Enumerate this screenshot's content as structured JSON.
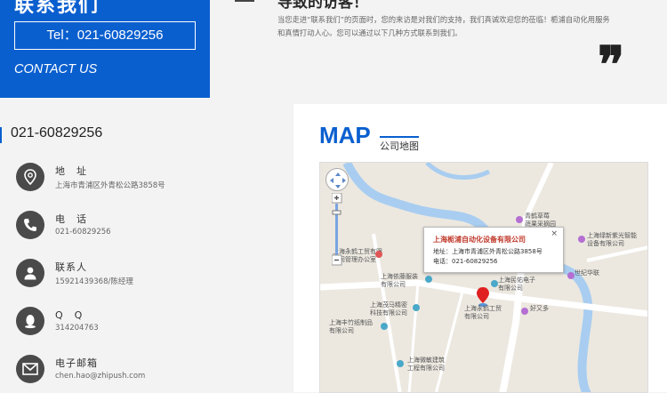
{
  "banner": {
    "title": "联系我们",
    "tel": "Tel：021-60829256",
    "contact_us": "CONTACT US"
  },
  "intro": {
    "heading": "导致的访客！",
    "text": "当您走进“联系我们”的页面时，您的来访是对我们的支持，我们真诚欢迎您的莅临！栀浦自动化用服务和真情打动人心。您可以通过以下几种方式联系到我们。",
    "quote": "❞"
  },
  "contact": {
    "phone_heading": "021-60829256",
    "items": [
      {
        "icon": "location-pin-icon",
        "label": "地　址",
        "value": "上海市青浦区外青松公路3858号"
      },
      {
        "icon": "phone-icon",
        "label": "电　话",
        "value": "021-60829256"
      },
      {
        "icon": "person-icon",
        "label": "联系人",
        "value": "15921439368/陈经理"
      },
      {
        "icon": "qq-icon",
        "label": "Q　Q",
        "value": "314204763"
      },
      {
        "icon": "email-icon",
        "label": "电子邮箱",
        "value": "chen.hao@zhipush.com"
      }
    ]
  },
  "map": {
    "title": "MAP",
    "subtitle": "公司地图",
    "popup": {
      "title": "上海栀浦自动化设备有限公司",
      "address": "地址：上海市青浦区外青松公路3858号",
      "phone": "电话：021-60829256",
      "close": "×"
    },
    "labels": [
      {
        "text": "青鹤草莓\n蔬果采摘园"
      },
      {
        "text": "上海绿新紫光智能\n设备有限公司"
      },
      {
        "text": "上海永鹤工贸有限\n公司管理办公室"
      },
      {
        "text": "上海民佑电子\n有限公司"
      },
      {
        "text": "上海依藤服装\n有限公司"
      },
      {
        "text": "上海永鹤工贸\n有限公司"
      },
      {
        "text": "上海茂马精密\n科技有限公司"
      },
      {
        "text": "上海丰竹纸制品\n有限公司"
      },
      {
        "text": "上海微敏建筑\n工程有限公司"
      },
      {
        "text": "世纪华联"
      },
      {
        "text": "好又多"
      }
    ],
    "colors": {
      "water": "#a8cdf0",
      "road": "#ffffff",
      "land": "#ece8e0",
      "marker": "#e02020"
    }
  },
  "colors": {
    "accent": "#0a5fcf",
    "icon_bg": "#4a4a4a"
  }
}
